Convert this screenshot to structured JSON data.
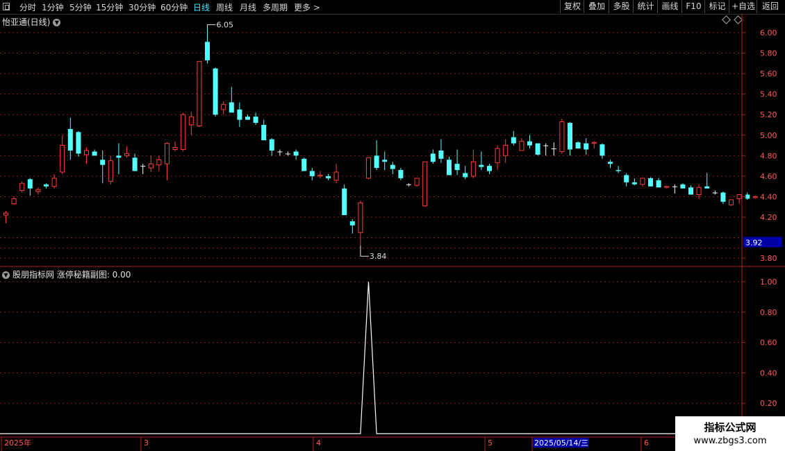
{
  "toolbar": {
    "tabs": [
      "分时",
      "1分钟",
      "5分钟",
      "15分钟",
      "30分钟",
      "60分钟",
      "日线",
      "周线",
      "月线",
      "多周期",
      "更多 >"
    ],
    "active_tab": "日线",
    "right_buttons": [
      "复权",
      "叠加",
      "多股",
      "统计",
      "画线",
      "F10",
      "标记",
      "+自选",
      "返回"
    ]
  },
  "main_panel": {
    "title": "怡亚通(日线)",
    "high_label": "6.05",
    "low_label": "3.84",
    "current_price": "3.92",
    "y_ticks": [
      "6.00",
      "5.80",
      "5.60",
      "5.40",
      "5.20",
      "5.00",
      "4.80",
      "4.60",
      "4.40",
      "4.20",
      "3.80"
    ]
  },
  "sub_panel": {
    "title": "股朋指标网  涨停秘籍副图: 0.00",
    "y_ticks": [
      "1.00",
      "0.80",
      "0.60",
      "0.40",
      "0.20"
    ]
  },
  "date_axis": {
    "labels": [
      "2025年",
      "3",
      "4",
      "5",
      "2025/05/14/三",
      "6"
    ]
  },
  "watermark": {
    "line1": "指标公式网",
    "line2": "www.zbgs3.com"
  },
  "colors": {
    "up": "#ff3d3d",
    "down": "#54ffff",
    "doji": "#ffffff",
    "grid": "#8b1a1a",
    "axis": "#b22222",
    "label": "#ff5a5a",
    "price_box": "#0000a8"
  },
  "chart_data": [
    {
      "type": "candlestick",
      "title": "怡亚通(日线)",
      "ylim": [
        3.75,
        6.12
      ],
      "y_ticks": [
        6.0,
        5.8,
        5.6,
        5.4,
        5.2,
        5.0,
        4.8,
        4.6,
        4.4,
        4.2,
        3.8
      ],
      "annotations": [
        {
          "text": "6.05",
          "value": 6.05
        },
        {
          "text": "3.84",
          "value": 3.84
        }
      ],
      "current_price": 3.92,
      "candles": [
        [
          4.22,
          4.26,
          4.14,
          4.24
        ],
        [
          4.33,
          4.4,
          4.32,
          4.38
        ],
        [
          4.46,
          4.55,
          4.44,
          4.53
        ],
        [
          4.57,
          4.58,
          4.41,
          4.48
        ],
        [
          4.45,
          4.49,
          4.42,
          4.47
        ],
        [
          4.52,
          4.53,
          4.48,
          4.5
        ],
        [
          4.5,
          4.62,
          4.48,
          4.58
        ],
        [
          4.64,
          5.0,
          4.62,
          4.9
        ],
        [
          5.06,
          5.17,
          4.76,
          4.85
        ],
        [
          5.03,
          5.04,
          4.79,
          4.82
        ],
        [
          4.81,
          4.88,
          4.72,
          4.85
        ],
        [
          4.84,
          4.86,
          4.8,
          4.8
        ],
        [
          4.76,
          4.85,
          4.53,
          4.71
        ],
        [
          4.55,
          4.8,
          4.52,
          4.75
        ],
        [
          4.8,
          4.92,
          4.62,
          4.78
        ],
        [
          4.8,
          4.89,
          4.78,
          4.82
        ],
        [
          4.78,
          4.82,
          4.65,
          4.65
        ],
        [
          4.7,
          4.72,
          4.62,
          4.7
        ],
        [
          4.68,
          4.8,
          4.64,
          4.72
        ],
        [
          4.71,
          4.8,
          4.65,
          4.76
        ],
        [
          4.72,
          4.93,
          4.56,
          4.92
        ],
        [
          4.86,
          4.94,
          4.84,
          4.88
        ],
        [
          4.86,
          5.22,
          4.84,
          5.2
        ],
        [
          5.1,
          5.23,
          5.0,
          5.18
        ],
        [
          5.09,
          5.72,
          5.08,
          5.72
        ],
        [
          5.91,
          6.05,
          5.7,
          5.73
        ],
        [
          5.65,
          5.66,
          5.18,
          5.2
        ],
        [
          5.25,
          5.33,
          5.2,
          5.3
        ],
        [
          5.32,
          5.47,
          5.29,
          5.22
        ],
        [
          5.25,
          5.32,
          5.08,
          5.15
        ],
        [
          5.18,
          5.2,
          5.15,
          5.15
        ],
        [
          5.18,
          5.22,
          5.1,
          5.12
        ],
        [
          5.1,
          5.15,
          5.02,
          4.95
        ],
        [
          4.96,
          4.97,
          4.8,
          4.85
        ],
        [
          4.84,
          4.86,
          4.8,
          4.84
        ],
        [
          4.82,
          4.84,
          4.8,
          4.82
        ],
        [
          4.84,
          4.86,
          4.76,
          4.8
        ],
        [
          4.77,
          4.78,
          4.7,
          4.65
        ],
        [
          4.65,
          4.68,
          4.56,
          4.6
        ],
        [
          4.6,
          4.65,
          4.58,
          4.61
        ],
        [
          4.6,
          4.62,
          4.56,
          4.58
        ],
        [
          4.56,
          4.72,
          4.53,
          4.64
        ],
        [
          4.48,
          4.52,
          4.38,
          4.22
        ],
        [
          4.16,
          4.18,
          4.04,
          4.12
        ],
        [
          4.05,
          4.36,
          3.84,
          4.34
        ],
        [
          4.58,
          4.78,
          4.57,
          4.78
        ],
        [
          4.8,
          4.95,
          4.66,
          4.68
        ],
        [
          4.76,
          4.84,
          4.66,
          4.74
        ],
        [
          4.71,
          4.74,
          4.62,
          4.67
        ],
        [
          4.66,
          4.68,
          4.56,
          4.58
        ],
        [
          4.52,
          4.53,
          4.5,
          4.52
        ],
        [
          4.51,
          4.56,
          4.5,
          4.58
        ],
        [
          4.31,
          4.74,
          4.3,
          4.74
        ],
        [
          4.82,
          4.86,
          4.72,
          4.74
        ],
        [
          4.85,
          4.96,
          4.73,
          4.77
        ],
        [
          4.76,
          4.79,
          4.61,
          4.61
        ],
        [
          4.72,
          4.86,
          4.61,
          4.66
        ],
        [
          4.63,
          4.7,
          4.57,
          4.59
        ],
        [
          4.6,
          4.86,
          4.58,
          4.74
        ],
        [
          4.71,
          4.84,
          4.66,
          4.69
        ],
        [
          4.7,
          4.72,
          4.62,
          4.65
        ],
        [
          4.73,
          4.9,
          4.66,
          4.87
        ],
        [
          4.8,
          4.96,
          4.73,
          4.9
        ],
        [
          4.98,
          5.04,
          4.9,
          4.92
        ],
        [
          4.85,
          4.97,
          4.86,
          4.94
        ],
        [
          4.94,
          5.0,
          4.87,
          4.9
        ],
        [
          4.92,
          4.92,
          4.8,
          4.81
        ],
        [
          4.9,
          4.92,
          4.8,
          4.9
        ],
        [
          4.87,
          4.93,
          4.8,
          4.87
        ],
        [
          4.84,
          5.16,
          4.82,
          5.13
        ],
        [
          5.12,
          5.13,
          4.8,
          4.86
        ],
        [
          4.93,
          4.94,
          4.87,
          4.87
        ],
        [
          4.92,
          4.97,
          4.81,
          4.86
        ],
        [
          4.92,
          4.94,
          4.87,
          4.93
        ],
        [
          4.91,
          4.92,
          4.77,
          4.8
        ],
        [
          4.74,
          4.76,
          4.68,
          4.72
        ],
        [
          4.66,
          4.7,
          4.63,
          4.65
        ],
        [
          4.61,
          4.63,
          4.5,
          4.54
        ],
        [
          4.54,
          4.58,
          4.51,
          4.52
        ],
        [
          4.52,
          4.57,
          4.5,
          4.58
        ],
        [
          4.58,
          4.59,
          4.5,
          4.5
        ],
        [
          4.56,
          4.58,
          4.49,
          4.49
        ],
        [
          4.49,
          4.5,
          4.48,
          4.5
        ],
        [
          4.5,
          4.52,
          4.43,
          4.5
        ],
        [
          4.52,
          4.53,
          4.48,
          4.48
        ],
        [
          4.49,
          4.51,
          4.42,
          4.42
        ],
        [
          4.42,
          4.52,
          4.38,
          4.49
        ],
        [
          4.5,
          4.63,
          4.48,
          4.48
        ],
        [
          4.44,
          4.46,
          4.42,
          4.44
        ],
        [
          4.44,
          4.45,
          4.33,
          4.35
        ],
        [
          4.32,
          4.36,
          4.31,
          4.37
        ],
        [
          4.38,
          4.42,
          4.33,
          4.42
        ],
        [
          4.42,
          4.44,
          4.37,
          4.38
        ],
        [
          4.39,
          4.41,
          4.38,
          4.4
        ]
      ]
    },
    {
      "type": "line",
      "title": "涨停秘籍副图",
      "ylim": [
        0,
        1.05
      ],
      "y_ticks": [
        1.0,
        0.8,
        0.6,
        0.4,
        0.2
      ],
      "series": [
        {
          "values": [
            0,
            0,
            0,
            0,
            0,
            0,
            0,
            0,
            0,
            0,
            0,
            0,
            0,
            0,
            0,
            0,
            0,
            0,
            0,
            0,
            0,
            0,
            0,
            0,
            0,
            0,
            0,
            0,
            0,
            0,
            0,
            0,
            0,
            0,
            0,
            0,
            0,
            0,
            0,
            0,
            0,
            0,
            0,
            0,
            0,
            1,
            0,
            0,
            0,
            0,
            0,
            0,
            0,
            0,
            0,
            0,
            0,
            0,
            0,
            0,
            0,
            0,
            0,
            0,
            0,
            0,
            0,
            0,
            0,
            0,
            0,
            0,
            0,
            0,
            0,
            0,
            0,
            0,
            0,
            0,
            0,
            0,
            0,
            0,
            0,
            0,
            0,
            0,
            0,
            0,
            0,
            0,
            0,
            0
          ]
        }
      ]
    }
  ]
}
